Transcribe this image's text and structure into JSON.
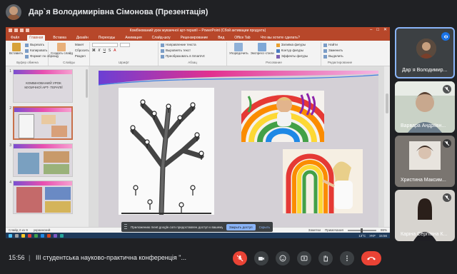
{
  "presenter": {
    "title": "Дар`я Володимирівна Сімонова (Презентація)"
  },
  "powerpoint": {
    "window_title": "Комбінований урок мувзичної арт-терапії – PowerPoint (Сбой активации продукта)",
    "tabs": [
      "Файл",
      "Главная",
      "Вставка",
      "Дизайн",
      "Переходы",
      "Анимация",
      "Слайд-шоу",
      "Рецензирование",
      "Вид",
      "Office Tab",
      "Что вы хотите сделать?"
    ],
    "ribbon": {
      "clipboard_items": [
        "Вырезать",
        "Копировать",
        "Формат по образцу"
      ],
      "paste_label": "Вставить",
      "clipboard_group": "Буфер обмена",
      "slides_items": [
        "Макет",
        "Сбросить",
        "Раздел"
      ],
      "create_slide_label": "Создать слайд",
      "slides_group": "Слайды",
      "font_group": "Шрифт",
      "paragraph_items": [
        "Направление текста",
        "Выровнять текст",
        "Преобразовать в SmartArt"
      ],
      "paragraph_group": "Абзац",
      "arrange_label": "Упорядочить",
      "express_styles_label": "Экспресс-стили",
      "drawing_items": [
        "Заливка фигуры",
        "Контур фигуры",
        "Эффекты фигуры"
      ],
      "drawing_group": "Рисование",
      "editing_items": [
        "Найти",
        "Заменить",
        "Выделить"
      ],
      "editing_group": "Редактирование"
    },
    "thumbnails": [
      {
        "num": "1",
        "text": "КОМБІНОВАНИЙ УРОК МУЗИЧНОЇ АРТ- ТЕРАПІЇ"
      },
      {
        "num": "2",
        "text": ""
      },
      {
        "num": "3",
        "text": ""
      },
      {
        "num": "4",
        "text": ""
      }
    ],
    "status": {
      "slide": "Слайд 2 из 9",
      "language": "украинский",
      "notes": "Заметки",
      "comments": "Примечания",
      "zoom": "86%"
    },
    "taskbar": {
      "temp": "13°C",
      "lang": "УКР",
      "time": "15:56"
    }
  },
  "share_banner": {
    "message": "Приложению meet.google.com предоставлен доступ к вашему экрану.",
    "stop_label": "Закрыть доступ",
    "hide_label": "Скрыть"
  },
  "participants": [
    {
      "name": "Дар`я Володимир...",
      "state": "speaking"
    },
    {
      "name": "Варвара Андріївн...",
      "state": "muted"
    },
    {
      "name": "Христина Максим...",
      "state": "muted"
    },
    {
      "name": "Каріна Сергіївна К...",
      "state": "muted"
    }
  ],
  "call_bar": {
    "time": "15:56",
    "separator": "|",
    "meeting_title": "ІІІ студентська науково-практична конференція \"...",
    "controls": [
      "mic-off-icon",
      "camera-icon",
      "emoji-icon",
      "present-icon",
      "raise-hand-icon",
      "more-icon",
      "end-call-icon"
    ]
  },
  "colors": {
    "meet_bg": "#202124",
    "ppt_accent": "#b7472a",
    "end_call": "#ea4335",
    "selected_tile": "#8ab4f8"
  }
}
